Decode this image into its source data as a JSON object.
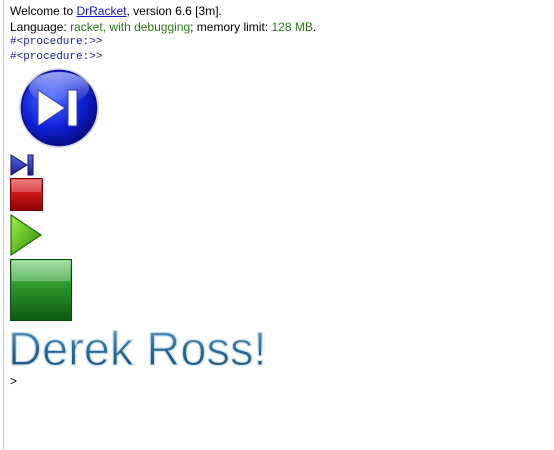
{
  "welcome": {
    "prefix": "Welcome to ",
    "link": "DrRacket",
    "suffix": ", version 6.6 [3m]."
  },
  "language": {
    "prefix": "Language: ",
    "value": "racket, with debugging",
    "middle": "; memory limit: ",
    "memory": "128 MB",
    "suffix": "."
  },
  "output": {
    "proc1": "#<procedure:>>",
    "proc2": "#<procedure:>>",
    "banner_text": "Derek Ross!"
  },
  "prompt": ">",
  "colors": {
    "link": "#1414cc",
    "language_value": "#2a7a18",
    "procedure": "#2020a8",
    "banner_fill": "#2a6a9a",
    "banner_stroke": "#c8e0f0"
  },
  "icons": [
    "step-next-icon",
    "step-next-icon",
    "stop-icon",
    "play-icon",
    "green-square-icon"
  ]
}
